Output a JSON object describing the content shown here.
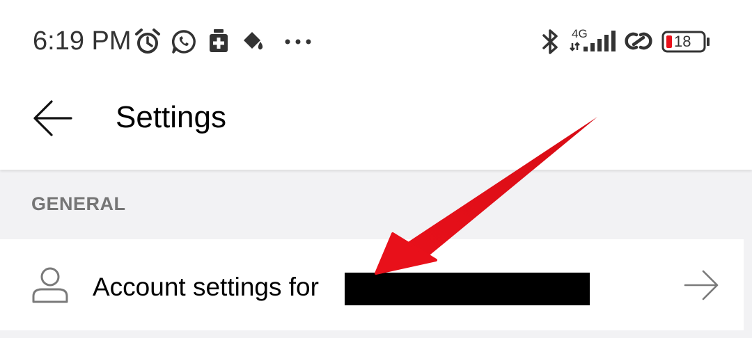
{
  "status_bar": {
    "time": "6:19 PM",
    "network_type": "4G",
    "battery_level": "18",
    "icons": [
      "alarm-icon",
      "whatsapp-icon",
      "medical-app-icon",
      "paint-bucket-icon",
      "more-dots-icon",
      "bluetooth-icon",
      "signal-icon",
      "hotspot-link-icon",
      "battery-icon"
    ]
  },
  "app_bar": {
    "title": "Settings"
  },
  "section": {
    "header": "GENERAL"
  },
  "rows": [
    {
      "label": "Account settings for",
      "icon": "person-icon",
      "trailing_icon": "arrow-right-icon"
    }
  ],
  "colors": {
    "app_bar_bg": "#ffffff",
    "page_bg": "#f2f2f4",
    "section_header": "#757575",
    "icon_gray": "#7a7a7a",
    "annotation_red": "#e8101a",
    "battery_low": "#e8101a"
  }
}
